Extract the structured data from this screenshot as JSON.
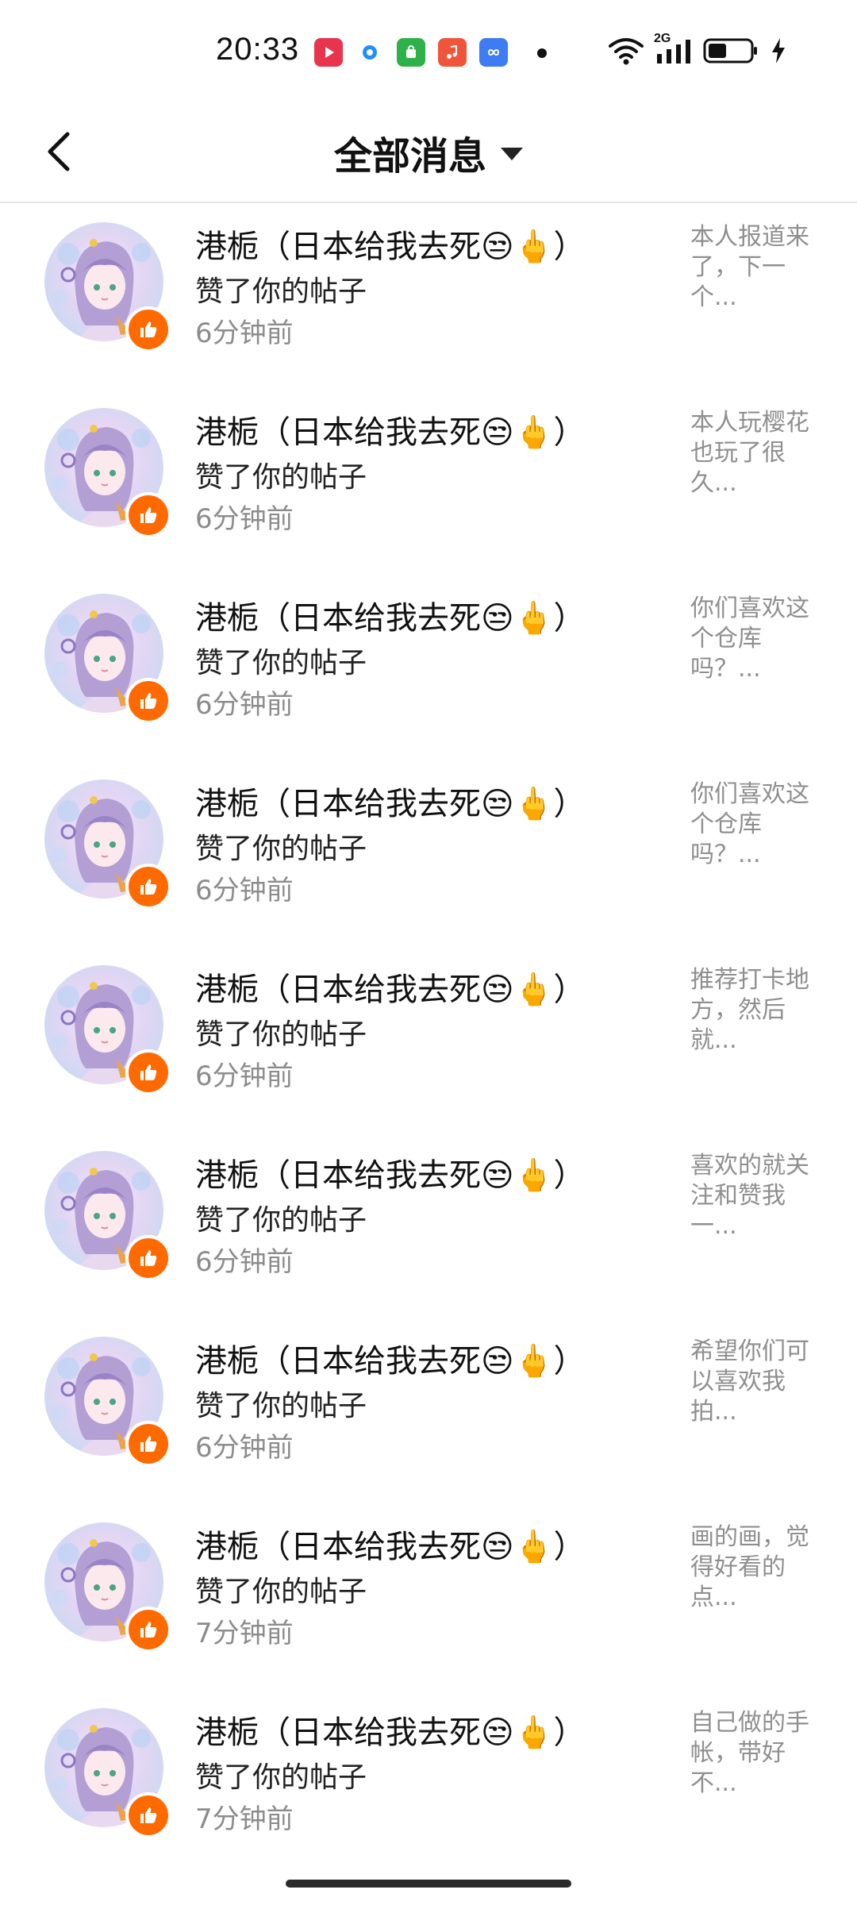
{
  "status_bar": {
    "time": "20:33",
    "network": "2G"
  },
  "header": {
    "title": "全部消息"
  },
  "notifications": [
    {
      "username": "港栀（日本给我去死😒🖕）",
      "action": "赞了你的帖子",
      "time_ago": "6分钟前",
      "preview": "本人报道来了，下一个..."
    },
    {
      "username": "港栀（日本给我去死😒🖕）",
      "action": "赞了你的帖子",
      "time_ago": "6分钟前",
      "preview": "本人玩樱花也玩了很久..."
    },
    {
      "username": "港栀（日本给我去死😒🖕）",
      "action": "赞了你的帖子",
      "time_ago": "6分钟前",
      "preview": "你们喜欢这个仓库吗？..."
    },
    {
      "username": "港栀（日本给我去死😒🖕）",
      "action": "赞了你的帖子",
      "time_ago": "6分钟前",
      "preview": "你们喜欢这个仓库吗？..."
    },
    {
      "username": "港栀（日本给我去死😒🖕）",
      "action": "赞了你的帖子",
      "time_ago": "6分钟前",
      "preview": "推荐打卡地方，然后就..."
    },
    {
      "username": "港栀（日本给我去死😒🖕）",
      "action": "赞了你的帖子",
      "time_ago": "6分钟前",
      "preview": "喜欢的就关注和赞我一..."
    },
    {
      "username": "港栀（日本给我去死😒🖕）",
      "action": "赞了你的帖子",
      "time_ago": "6分钟前",
      "preview": "希望你们可以喜欢我拍..."
    },
    {
      "username": "港栀（日本给我去死😒🖕）",
      "action": "赞了你的帖子",
      "time_ago": "7分钟前",
      "preview": "画的画，觉得好看的点..."
    },
    {
      "username": "港栀（日本给我去死😒🖕）",
      "action": "赞了你的帖子",
      "time_ago": "7分钟前",
      "preview": "自己做的手帐，带好不..."
    }
  ],
  "colors": {
    "badge": "#ff6a00",
    "secondary_text": "#8c8c8c"
  }
}
